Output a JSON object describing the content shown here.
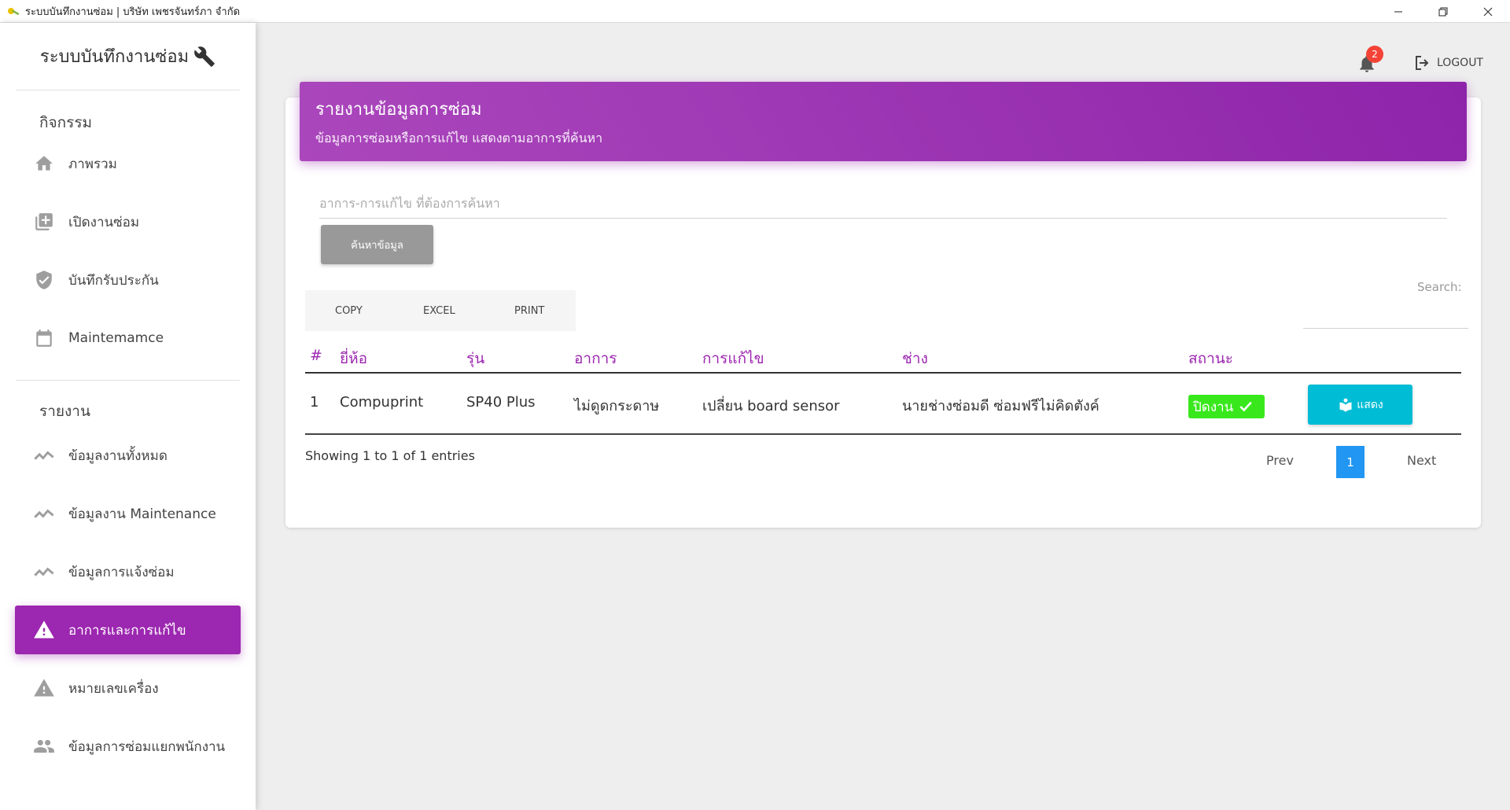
{
  "window": {
    "title": "ระบบบันทึกงานซ่อม | บริษัท เพชรจันทร์ภา จำกัด"
  },
  "sidebar": {
    "brand": "ระบบบันทึกงานซ่อม",
    "section_activities": "กิจกรรม",
    "section_reports": "รายงาน",
    "items": [
      {
        "label": "ภาพรวม",
        "icon": "home-icon"
      },
      {
        "label": "เปิดงานซ่อม",
        "icon": "add-box-icon"
      },
      {
        "label": "บันทึกรับประกัน",
        "icon": "shield-check-icon"
      },
      {
        "label": "Maintemamce",
        "icon": "calendar-icon"
      },
      {
        "label": "ข้อมูลงานทั้งหมด",
        "icon": "trending-icon"
      },
      {
        "label": "ข้อมูลงาน Maintenance",
        "icon": "trending-icon"
      },
      {
        "label": "ข้อมูลการแจ้งซ่อม",
        "icon": "trending-icon"
      },
      {
        "label": "อาการและการแก้ไข",
        "icon": "warning-icon",
        "active": true
      },
      {
        "label": "หมายเลขเครื่อง",
        "icon": "warning-icon"
      },
      {
        "label": "ข้อมูลการซ่อมแยกพนักงาน",
        "icon": "people-icon"
      }
    ]
  },
  "topbar": {
    "notification_count": "2",
    "logout_label": "LOGOUT"
  },
  "card": {
    "title": "รายงานข้อมูลการซ่อม",
    "subtitle": "ข้อมูลการซ่อมหรือการแก้ไข แสดงตามอาการที่ค้นหา",
    "search_placeholder": "อาการ-การแก้ไข ที่ต้องการค้นหา",
    "search_button": "ค้นหาข้อมูล"
  },
  "datatable": {
    "buttons": {
      "copy": "COPY",
      "excel": "EXCEL",
      "print": "PRINT"
    },
    "search_label": "Search:",
    "columns": [
      "#",
      "ยี่ห้อ",
      "รุ่น",
      "อาการ",
      "การแก้ไข",
      "ช่าง",
      "สถานะ"
    ],
    "rows": [
      {
        "no": "1",
        "brand": "Compuprint",
        "model": "SP40 Plus",
        "symptom": "ไม่ดูดกระดาษ",
        "fix": "เปลี่ยน board sensor",
        "technician": "นายช่างซ่อมดี ซ่อมฟรีไม่คิดตังค์",
        "status": "ปิดงาน",
        "action": "แสดง"
      }
    ],
    "info": "Showing 1 to 1 of 1 entries",
    "pagination": {
      "prev": "Prev",
      "current": "1",
      "next": "Next"
    }
  },
  "colors": {
    "accent": "#9c27b0",
    "status_closed": "#39e81c",
    "show_button": "#00bcd4",
    "page_active": "#2196f3"
  }
}
